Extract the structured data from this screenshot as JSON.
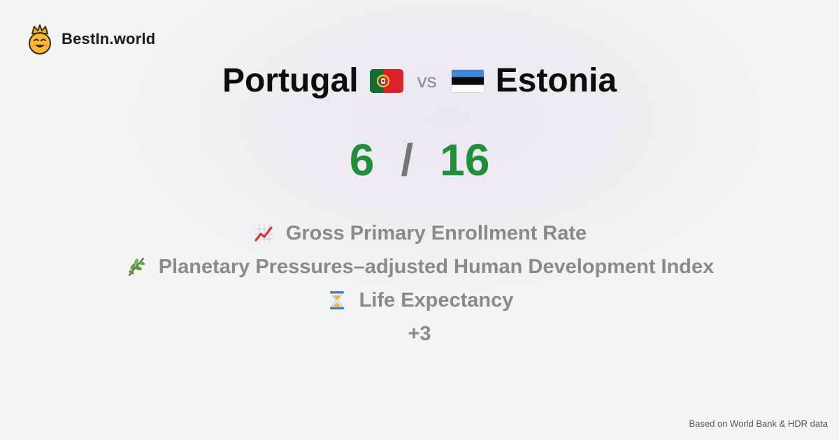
{
  "brand": {
    "name": "BestIn.world",
    "logo_icon": "smiling-crown-face-icon"
  },
  "comparison": {
    "country_a": {
      "name": "Portugal",
      "flag_icon": "portugal-flag-icon"
    },
    "vs_label": "vs",
    "country_b": {
      "name": "Estonia",
      "flag_icon": "estonia-flag-icon"
    }
  },
  "score": {
    "a": "6",
    "separator": "/",
    "b": "16"
  },
  "metrics": [
    {
      "icon": "chart-increasing-icon",
      "label": "Gross Primary Enrollment Rate"
    },
    {
      "icon": "herb-icon",
      "label": "Planetary Pressures–adjusted Human Development Index"
    },
    {
      "icon": "hourglass-icon",
      "label": "Life Expectancy"
    }
  ],
  "more_label": "+3",
  "footer": {
    "source": "Based on World Bank & HDR data"
  },
  "colors": {
    "score": "#1f8f3a",
    "muted": "#8a8a8a",
    "text": "#0d0d0d"
  }
}
